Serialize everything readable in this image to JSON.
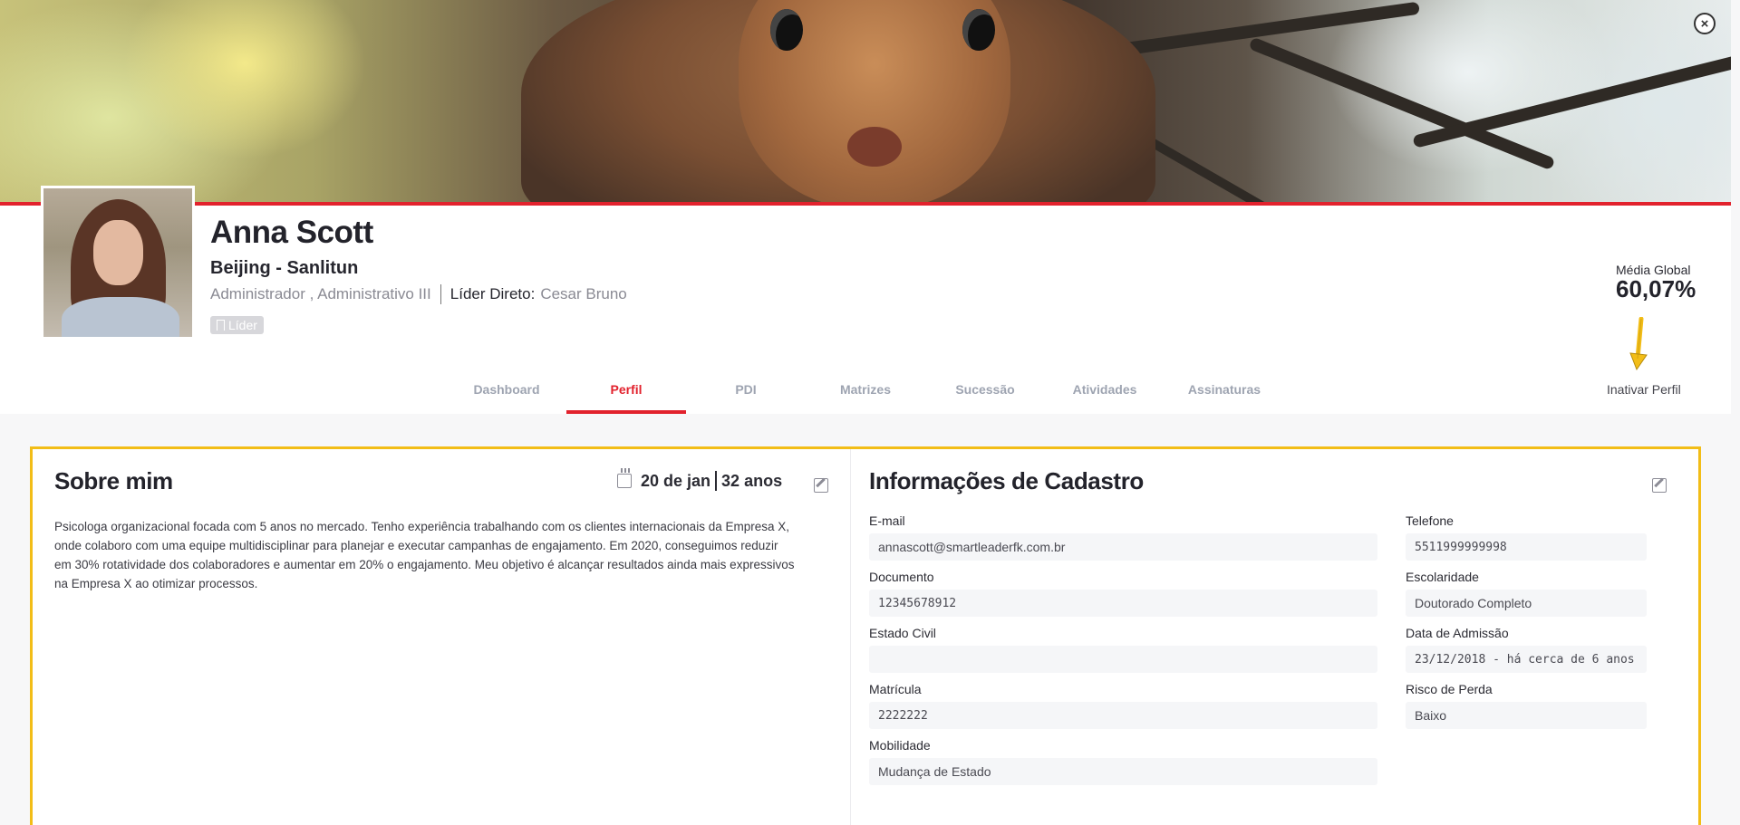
{
  "profile": {
    "name": "Anna Scott",
    "location": "Beijing - Sanlitun",
    "roles": "Administrador , Administrativo III",
    "leader_label": "Líder Direto:",
    "leader_name": "Cesar Bruno",
    "badge": "Líder"
  },
  "metrics": {
    "media_label": "Média Global",
    "media_value": "60,07%"
  },
  "actions": {
    "inactivate": "Inativar Perfil",
    "close": "×"
  },
  "tabs": [
    {
      "label": "Dashboard"
    },
    {
      "label": "Perfil",
      "active": true
    },
    {
      "label": "PDI"
    },
    {
      "label": "Matrizes"
    },
    {
      "label": "Sucessão"
    },
    {
      "label": "Atividades"
    },
    {
      "label": "Assinaturas"
    }
  ],
  "about": {
    "title": "Sobre mim",
    "birth_date": "20 de jan",
    "age": "32 anos",
    "text": "Psicologa organizacional focada com 5 anos no mercado. Tenho experiência trabalhando com os clientes internacionais da Empresa X, onde colaboro com uma equipe multidisciplinar para planejar e executar campanhas de engajamento. Em 2020, conseguimos reduzir em 30% rotatividade dos colaboradores e aumentar em 20% o engajamento. Meu objetivo é alcançar resultados ainda mais expressivos na Empresa X ao otimizar processos."
  },
  "registration": {
    "title": "Informações de Cadastro",
    "left_fields": [
      {
        "label": "E-mail",
        "value": "annascott@smartleaderfk.com.br"
      },
      {
        "label": "Documento",
        "value": "12345678912"
      },
      {
        "label": "Estado Civil",
        "value": ""
      },
      {
        "label": "Matrícula",
        "value": "2222222"
      },
      {
        "label": "Mobilidade",
        "value": "Mudança de Estado"
      }
    ],
    "right_fields": [
      {
        "label": "Telefone",
        "value": "5511999999998"
      },
      {
        "label": "Escolaridade",
        "value": "Doutorado Completo"
      },
      {
        "label": "Data de Admissão",
        "value": "23/12/2018 - há cerca de 6 anos"
      },
      {
        "label": "Risco de Perda",
        "value": "Baixo"
      }
    ]
  },
  "colors": {
    "accent": "#e2222d",
    "highlight_border": "#f2bd17",
    "arrow": "#f2bd17"
  }
}
